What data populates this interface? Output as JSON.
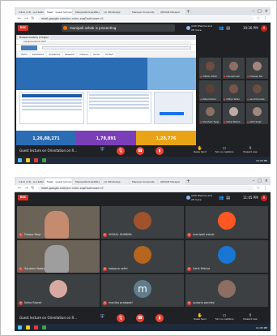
{
  "shot1": {
    "tabs": [
      {
        "label": "Inbox (13) - pocketkr@",
        "active": false
      },
      {
        "label": "Meet - Guest lecture",
        "active": true
      },
      {
        "label": "ManipalOnline(DRL)",
        "active": false
      },
      {
        "label": "(1) WhatsApp",
        "active": false
      },
      {
        "label": "Manipal University",
        "active": false
      },
      {
        "label": "QPSIAN Manipal",
        "active": false
      }
    ],
    "url": "meet.google.com/scr-nvhn-zqq?authuser=0",
    "rec_label": "REC",
    "presenting_text": "manipall ashok is presenting",
    "you_label": "Aditi Sharma and 28 more",
    "clock": "10:26 PM",
    "avatar_initial": "A",
    "shared_screen": {
      "tab_label": "Manipal Academy of Higher",
      "url": "manipal.edu/mu.html",
      "menu_items": [
        "Home",
        "Admissions",
        "Academics",
        "Research",
        "Campus",
        "Alumni",
        "Contact"
      ],
      "tiles": [
        {
          "value": "1,26,88,271",
          "color": "#2a6db5"
        },
        {
          "value": "1,78,891",
          "color": "#7a3fb8"
        },
        {
          "value": "1,28,776",
          "color": "#e8a317"
        }
      ]
    },
    "participants": [
      {
        "name": "VISHAL SHAR",
        "color": "#6d4c41"
      },
      {
        "name": "manipall ash",
        "color": "#8d6e63"
      },
      {
        "name": "Pradeep Pat",
        "color": "#a1887f"
      },
      {
        "name": "Rahul Kumar",
        "color": "#5d4037"
      },
      {
        "name": "Aditya Yadav",
        "color": "#795548"
      },
      {
        "name": "sanchit pande",
        "color": "#6d4c41"
      },
      {
        "name": "Shubham Tyagi",
        "color": "#8d6e63"
      },
      {
        "name": "Vishal Mishra",
        "color": "#bcaaa4"
      },
      {
        "name": "Akhil Singh",
        "color": "#a1887f"
      }
    ],
    "meeting_name": "Guest lecture on Orientation on R...",
    "raise_hand_label": "Raise hand",
    "present_label": "Turn on captions",
    "presenting_label": "Present now",
    "taskbar_clock": "10:26 PM"
  },
  "shot2": {
    "tabs": [
      {
        "label": "Inbox (13) - pocketkr@",
        "active": false
      },
      {
        "label": "Meet - Guest lecture",
        "active": true
      },
      {
        "label": "ManipalOnline(DRL)",
        "active": false
      },
      {
        "label": "(1) WhatsApp",
        "active": false
      },
      {
        "label": "Manipal University",
        "active": false
      },
      {
        "label": "QPSIAN Manipal",
        "active": false
      }
    ],
    "url": "meet.google.com/scr-nvhn-zqq?authuser=0",
    "rec_label": "REC",
    "you_label": "Aditi Sharma and 28 more",
    "clock": "11:05 PM",
    "avatar_initial": "A",
    "grid": [
      {
        "name": "Deepa Negi",
        "av": "",
        "color": "#c48b6e",
        "photo": true
      },
      {
        "name": "VISHAL SHARMA",
        "av": "",
        "color": "#a0522d",
        "photo": false
      },
      {
        "name": "manipall ashok",
        "av": "",
        "color": "#ff5722",
        "photo": false
      },
      {
        "name": "Sanjeev Yadav",
        "av": "",
        "color": "#9e9e9e",
        "photo": true
      },
      {
        "name": "kalpana sethi",
        "av": "",
        "color": "#b5651d",
        "photo": false
      },
      {
        "name": "Sahil Mishra",
        "av": "",
        "color": "#1976d2",
        "photo": false
      },
      {
        "name": "Neha Rawat",
        "av": "",
        "color": "#d7a9a0",
        "photo": false
      },
      {
        "name": "monika prajapati",
        "av": "m",
        "color": "#607d8b",
        "photo": false
      },
      {
        "name": "upasna pandey",
        "av": "",
        "color": "#8d6e63",
        "photo": false
      }
    ],
    "meeting_name": "Guest lecture on Orientation on R...",
    "raise_hand_label": "Raise hand",
    "present_label": "Turn on captions",
    "presenting_label": "Present now",
    "taskbar_clock": "11:05 PM"
  }
}
